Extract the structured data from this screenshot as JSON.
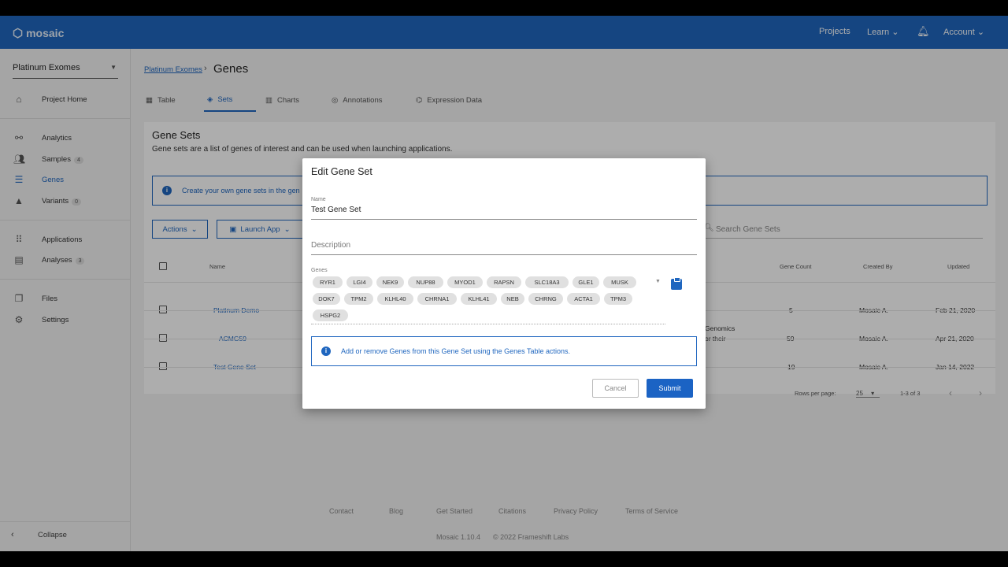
{
  "app": {
    "logo": "mosaic"
  },
  "topbar": {
    "projects": "Projects",
    "learn": "Learn",
    "account": "Account"
  },
  "sidebar": {
    "project": "Platinum Exomes",
    "items": [
      {
        "label": "Project Home"
      },
      {
        "label": "Analytics"
      },
      {
        "label": "Samples",
        "badge": "4"
      },
      {
        "label": "Genes"
      },
      {
        "label": "Variants",
        "badge": "0"
      },
      {
        "label": "Applications"
      },
      {
        "label": "Analyses",
        "badge": "3"
      },
      {
        "label": "Files"
      },
      {
        "label": "Settings"
      }
    ],
    "collapse": "Collapse"
  },
  "breadcrumb": {
    "link": "Platinum Exomes",
    "current": "Genes"
  },
  "tabs": [
    {
      "label": "Table"
    },
    {
      "label": "Sets"
    },
    {
      "label": "Charts"
    },
    {
      "label": "Annotations"
    },
    {
      "label": "Expression Data"
    }
  ],
  "card": {
    "title": "Gene Sets",
    "description": "Gene sets are a list of genes of interest and can be used when launching applications.",
    "info": "Create your own gene sets in the gen",
    "actions": "Actions",
    "launch": "Launch App",
    "search_placeholder": "Search Gene Sets",
    "columns": {
      "name": "Name",
      "gene_count": "Gene Count",
      "created_by": "Created By",
      "updated": "Updated"
    },
    "rows": [
      {
        "name": "Platinum Demo",
        "desc": "",
        "count": "5",
        "by": "Mosaic A.",
        "updated": "Feb 21, 2020"
      },
      {
        "name": "ACMG59",
        "desc": "Genomics",
        "desc2": "or their",
        "count": "59",
        "by": "Mosaic A.",
        "updated": "Apr 21, 2020"
      },
      {
        "name": "Test Gene Set",
        "desc": "",
        "count": "19",
        "by": "Mosaic A.",
        "updated": "Jan 14, 2022"
      }
    ],
    "rows_per_page_label": "Rows per page:",
    "rows_per_page": "25",
    "range": "1-3 of 3"
  },
  "footer": {
    "links": [
      "Contact",
      "Blog",
      "Get Started",
      "Citations",
      "Privacy Policy",
      "Terms of Service"
    ],
    "version": "Mosaic 1.10.4",
    "copyright": "© 2022 Frameshift Labs"
  },
  "dialog": {
    "title": "Edit Gene Set",
    "name_label": "Name",
    "name_value": "Test Gene Set",
    "description_placeholder": "Description",
    "genes_label": "Genes",
    "genes": [
      "RYR1",
      "LGI4",
      "NEK9",
      "NUP88",
      "MYOD1",
      "RAPSN",
      "SLC18A3",
      "GLE1",
      "MUSK",
      "DOK7",
      "TPM2",
      "KLHL40",
      "CHRNA1",
      "KLHL41",
      "NEB",
      "CHRNG",
      "ACTA1",
      "TPM3",
      "HSPG2"
    ],
    "info": "Add or remove Genes from this Gene Set using the Genes Table actions.",
    "cancel": "Cancel",
    "submit": "Submit"
  },
  "colors": {
    "primary": "#1f66bf",
    "topbar": "#1f66bf",
    "submit": "#1b63c4"
  }
}
